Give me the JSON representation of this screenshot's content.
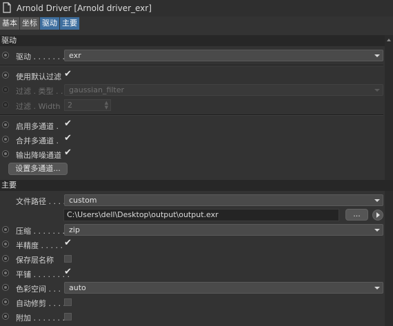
{
  "window": {
    "title": "Arnold Driver [Arnold driver_exr]",
    "icon": "document-icon"
  },
  "tabs": [
    {
      "label": "基本",
      "active": false
    },
    {
      "label": "坐标",
      "active": false
    },
    {
      "label": "驱动",
      "active": true
    },
    {
      "label": "主要",
      "active": true
    }
  ],
  "driver_section": {
    "header": "驱动",
    "driver": {
      "label": "驱动 . . . . . . . .",
      "value": "exr"
    },
    "use_default_filter": {
      "label": "使用默认过滤",
      "checked": true
    },
    "filter_type": {
      "label": "过滤 . 类型 . .",
      "value": "gaussian_filter",
      "enabled": false
    },
    "filter_width": {
      "label": "过滤 . Width",
      "value": "2",
      "enabled": false
    },
    "enable_multipass": {
      "label": "启用多通道 .",
      "checked": true
    },
    "merge_multipass": {
      "label": "合并多通道 .",
      "checked": true
    },
    "output_denoise": {
      "label": "输出降噪通道",
      "checked": true
    },
    "setup_multipass_button": "设置多通道..."
  },
  "main_section": {
    "header": "主要",
    "file_path": {
      "label": "文件路径 . . . .",
      "mode": "custom",
      "path": "C:\\Users\\dell\\Desktop\\output\\output.exr",
      "browse_label": "..."
    },
    "compression": {
      "label": "压缩 . . . . . . . .",
      "value": "zip"
    },
    "half_precision": {
      "label": "半精度 . . . . .",
      "checked": true
    },
    "preserve_layer_name": {
      "label": "保存层名称",
      "checked": false
    },
    "tiled": {
      "label": "平铺 . . . . . . . .",
      "checked": true
    },
    "color_space": {
      "label": "色彩空间 . . .",
      "value": "auto"
    },
    "autocrop": {
      "label": "自动修剪 . . . .",
      "checked": false
    },
    "append": {
      "label": "附加 . . . . . . . .",
      "checked": false
    }
  },
  "colors": {
    "accent": "#3f6f9f",
    "background": "#333333",
    "section_header": "#272727"
  }
}
